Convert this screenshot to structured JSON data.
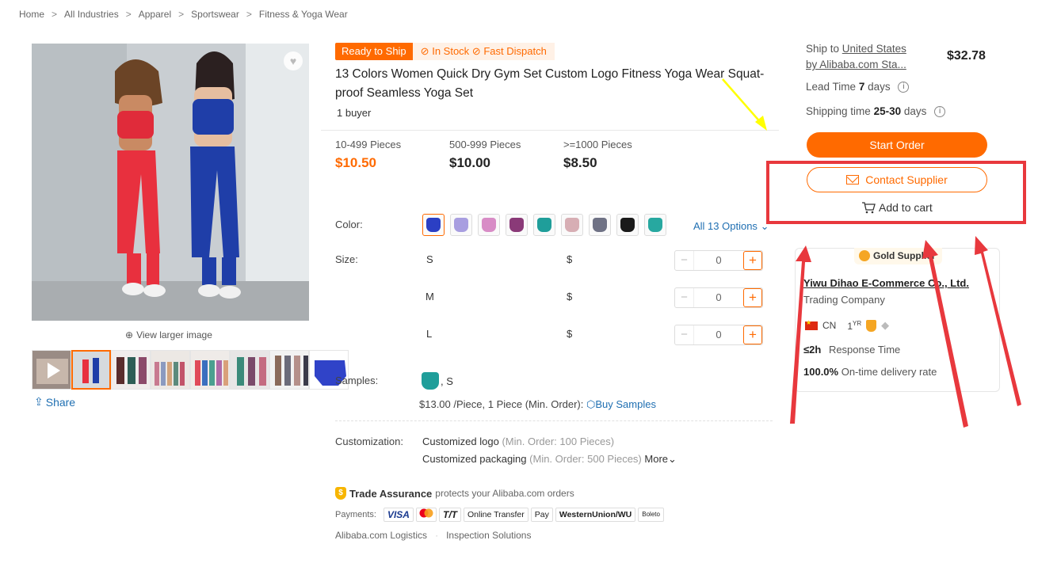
{
  "breadcrumb": [
    "Home",
    "All Industries",
    "Apparel",
    "Sportswear",
    "Fitness & Yoga Wear"
  ],
  "breadcrumb_sep": ">",
  "gallery": {
    "view_larger": "View larger image",
    "share": "Share"
  },
  "product": {
    "badge_ready": "Ready to Ship",
    "badge_stock": "In Stock",
    "badge_dispatch": "Fast Dispatch",
    "title": "13 Colors Women Quick Dry Gym Set Custom Logo Fitness Yoga Wear Squat-proof Seamless Yoga Set",
    "buyers": "1 buyer"
  },
  "tiers": [
    {
      "qty": "10-499 Pieces",
      "price": "$10.50"
    },
    {
      "qty": "500-999 Pieces",
      "price": "$10.00"
    },
    {
      "qty": ">=1000 Pieces",
      "price": "$8.50"
    }
  ],
  "color": {
    "label": "Color:",
    "all_options": "All 13 Options",
    "swatches": [
      "#2b3fc4",
      "#a89ee0",
      "#d88cc6",
      "#8a3a78",
      "#1f9e9a",
      "#d7aeb4",
      "#6f7285",
      "#1a1a1a",
      "#27a8a0"
    ]
  },
  "size": {
    "label": "Size:",
    "rows": [
      {
        "size": "S",
        "price": "$",
        "qty": "0"
      },
      {
        "size": "M",
        "price": "$",
        "qty": "0"
      },
      {
        "size": "L",
        "price": "$",
        "qty": "0"
      }
    ]
  },
  "samples": {
    "label": "Samples:",
    "variant": ", S",
    "info": "$13.00 /Piece, 1 Piece (Min. Order):",
    "buy": "Buy Samples"
  },
  "customization": {
    "label": "Customization:",
    "logo": "Customized logo",
    "logo_min": "(Min. Order: 100 Pieces)",
    "packaging": "Customized packaging",
    "packaging_min": "(Min. Order: 500 Pieces)",
    "more": "More"
  },
  "trade": {
    "title": "Trade Assurance",
    "desc": "protects your Alibaba.com orders",
    "payments_label": "Payments:",
    "payments": [
      "VISA",
      "MC",
      "T/T",
      "Online Transfer",
      "Pay",
      "WesternUnion/WU",
      "Boleto"
    ],
    "logistics": "Alibaba.com Logistics",
    "inspection": "Inspection Solutions"
  },
  "shipping": {
    "ship_to_prefix": "Ship to",
    "ship_to": "United States",
    "by": "by Alibaba.com Sta...",
    "price": "$32.78",
    "lead_label": "Lead Time",
    "lead_value": "7",
    "lead_unit": "days",
    "ship_time_label": "Shipping time",
    "ship_time_value": "25-30",
    "ship_time_unit": "days"
  },
  "actions": {
    "start_order": "Start Order",
    "contact": "Contact Supplier",
    "add_cart": "Add to cart"
  },
  "supplier": {
    "badge": "Gold Supplier",
    "name": "Yiwu Dihao E-Commerce Co., Ltd.",
    "type": "Trading Company",
    "country": "CN",
    "years": "1",
    "years_unit": "YR",
    "response_value": "≤2h",
    "response_label": "Response Time",
    "ontime_value": "100.0%",
    "ontime_label": "On-time delivery rate"
  },
  "colors": {
    "accent": "#ff6a00",
    "link": "#1f6fb2",
    "annotation_red": "#e8383d",
    "annotation_yellow": "#ffff00"
  }
}
